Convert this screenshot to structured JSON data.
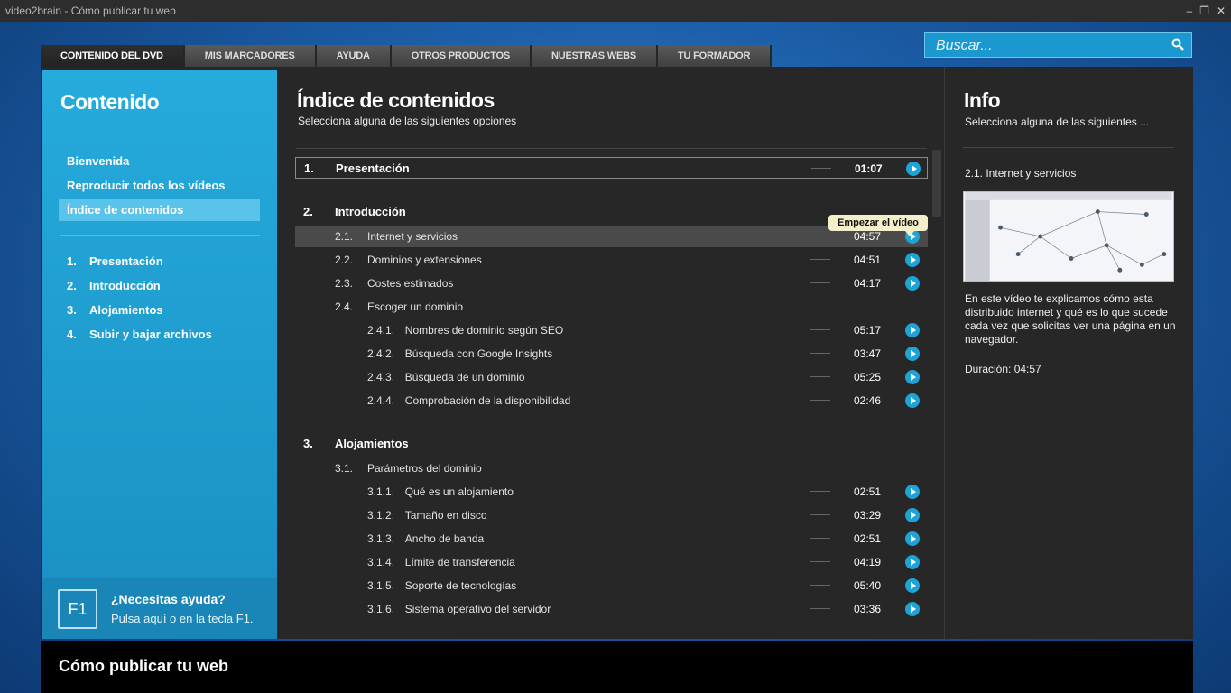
{
  "window": {
    "title": "video2brain - Cómo publicar tu web",
    "controls": [
      "–",
      "❐",
      "✕"
    ]
  },
  "tabs": [
    "CONTENIDO DEL DVD",
    "MIS MARCADORES",
    "AYUDA",
    "OTROS PRODUCTOS",
    "NUESTRAS WEBS",
    "TU FORMADOR"
  ],
  "search": {
    "placeholder": "Buscar..."
  },
  "sidebar": {
    "title": "Contenido",
    "nav": [
      "Bienvenida",
      "Reproducir todos los vídeos",
      "Índice de contenidos"
    ],
    "chapters": [
      {
        "num": "1.",
        "label": "Presentación"
      },
      {
        "num": "2.",
        "label": "Introducción"
      },
      {
        "num": "3.",
        "label": "Alojamientos"
      },
      {
        "num": "4.",
        "label": "Subir y bajar archivos"
      }
    ],
    "help": {
      "key": "F1",
      "title": "¿Necesitas ayuda?",
      "text": "Pulsa aquí o en la tecla F1."
    }
  },
  "main": {
    "title": "Índice de contenidos",
    "subtitle": "Selecciona alguna de las siguientes opciones",
    "tooltip": "Empezar el vídeo",
    "rows": [
      {
        "num": "1.",
        "label": "Presentación",
        "duration": "01:07"
      },
      {
        "num": "2.",
        "label": "Introducción",
        "duration": ""
      },
      {
        "num": "2.1.",
        "label": "Internet y servicios",
        "duration": "04:57"
      },
      {
        "num": "2.2.",
        "label": "Dominios y extensiones",
        "duration": "04:51"
      },
      {
        "num": "2.3.",
        "label": "Costes estimados",
        "duration": "04:17"
      },
      {
        "num": "2.4.",
        "label": "Escoger un dominio",
        "duration": ""
      },
      {
        "num": "2.4.1.",
        "label": "Nombres de dominio según SEO",
        "duration": "05:17"
      },
      {
        "num": "2.4.2.",
        "label": "Búsqueda con Google Insights",
        "duration": "03:47"
      },
      {
        "num": "2.4.3.",
        "label": "Búsqueda de un dominio",
        "duration": "05:25"
      },
      {
        "num": "2.4.4.",
        "label": "Comprobación de la disponibilidad",
        "duration": "02:46"
      },
      {
        "num": "3.",
        "label": "Alojamientos",
        "duration": ""
      },
      {
        "num": "3.1.",
        "label": "Parámetros del dominio",
        "duration": ""
      },
      {
        "num": "3.1.1.",
        "label": "Qué es un alojamiento",
        "duration": "02:51"
      },
      {
        "num": "3.1.2.",
        "label": "Tamaño en disco",
        "duration": "03:29"
      },
      {
        "num": "3.1.3.",
        "label": "Ancho de banda",
        "duration": "02:51"
      },
      {
        "num": "3.1.4.",
        "label": "Límite de transferencia",
        "duration": "04:19"
      },
      {
        "num": "3.1.5.",
        "label": "Soporte de tecnologías",
        "duration": "05:40"
      },
      {
        "num": "3.1.6.",
        "label": "Sistema operativo del servidor",
        "duration": "03:36"
      }
    ]
  },
  "info": {
    "title": "Info",
    "subtitle": "Selecciona alguna de las siguientes ...",
    "video_title": "2.1. Internet y servicios",
    "description": "En este vídeo te explicamos cómo esta distribuido internet y qué es lo que sucede cada vez que solicitas ver una página en un navegador.",
    "duration": "Duración: 04:57"
  },
  "footer": {
    "title": "Cómo publicar tu web"
  },
  "colors": {
    "accent": "#1da3d8",
    "sidebar": "#25abdc",
    "panel": "#272727"
  }
}
